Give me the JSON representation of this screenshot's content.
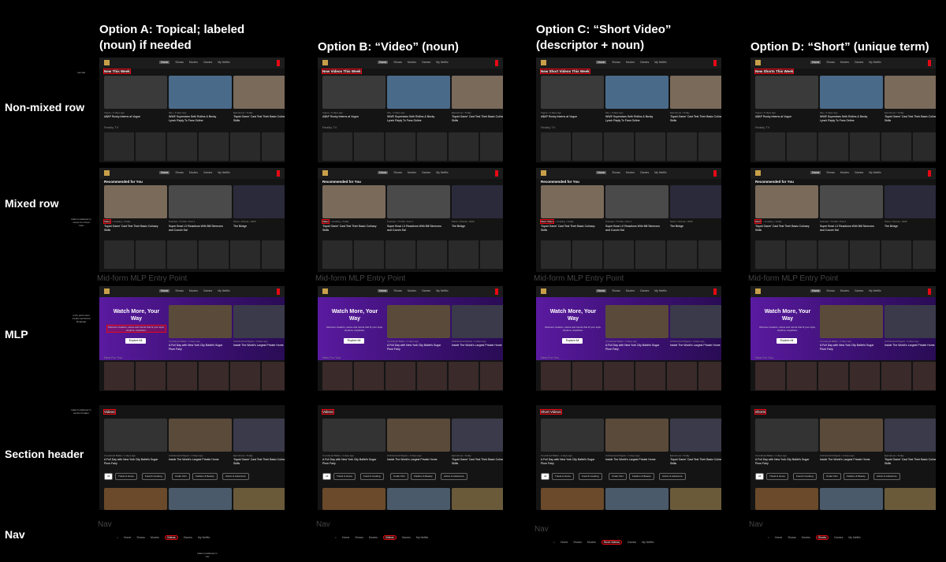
{
  "columns": [
    {
      "title": "Option A: Topical; labeled (noun) if needed",
      "nonmixed_row_title": "New This Week",
      "mixed_label": "Video",
      "section_header": "Videos",
      "nav_label": "Videos"
    },
    {
      "title": "Option B: “Video” (noun)",
      "nonmixed_row_title": "New Videos This Week",
      "mixed_label": "Video",
      "section_header": "Videos",
      "nav_label": "Videos"
    },
    {
      "title": "Option C: “Short Video” (descriptor + noun)",
      "nonmixed_row_title": "New Short Videos This Week",
      "mixed_label": "Short Video",
      "section_header": "Short Videos",
      "nav_label": "Short Videos"
    },
    {
      "title": "Option D: “Short” (unique term)",
      "nonmixed_row_title": "New Shorts This Week",
      "mixed_label": "Short",
      "section_header": "Shorts",
      "nav_label": "Shorts"
    }
  ],
  "row_labels": {
    "nonmixed": "Non-mixed row",
    "mixed": "Mixed row",
    "mlp": "MLP",
    "section": "Section header",
    "nav": "Nav"
  },
  "annotations": {
    "nonmixed": "row title",
    "mixed": "label considered in scope for mixed rows",
    "mlp": "entry point uses creator-anchored language",
    "section": "label considered in section header",
    "nav": "label considered in nav"
  },
  "top_nav": [
    "Home",
    "Shows",
    "Movies",
    "Games",
    "My Netflix"
  ],
  "bottom_nav": [
    "Home",
    "Shows",
    "Movies",
    "Games",
    "My Netflix"
  ],
  "nonmixed": {
    "cards": [
      {
        "meta": "Vogue • 5 days ago",
        "title": "A$AP Rocky Interns at Vogue"
      },
      {
        "meta": "Sky • 3 days ago",
        "title": "WWE Superstars Seth Rollins & Becky Lynch Reply To Fans Online"
      },
      {
        "meta": "Epicurious • Today",
        "title": "'Squid Game' Cast Test Their Basic Culinary Skills"
      }
    ],
    "sub": "Reality TV"
  },
  "mixed": {
    "row_title": "Recommended for You",
    "cards": [
      {
        "meta": "• Cooking • Today",
        "title": "'Squid Game' Cast Test Their Basic Culinary Skills"
      },
      {
        "meta": "Podcast • TV-MA • Part 1",
        "title": "Super Bowl LX Reactions With Bill Simmons and Cousin Sal"
      },
      {
        "meta": "Show • Drama • 2026",
        "title": "The Bridge"
      }
    ]
  },
  "mlp": {
    "caption": "Mid-form MLP Entry Point",
    "heading": "Watch More, Your Way",
    "body": "Discover creators, series and trends that fit your style, anytime, anywhere.",
    "button": "Explore All",
    "cards": [
      {
        "meta": "Crosslined Ballet • 4 days ago",
        "title": "A Full Day with New York City Ballet's Sugar Plum Fairy"
      },
      {
        "meta": "Architectural Digest • 3 days ago",
        "title": "Inside The World's Largest Private Home"
      }
    ],
    "sub": "New For You"
  },
  "section": {
    "cards": [
      {
        "meta": "Crosslined Ballet • 4 days ago",
        "title": "A Full Day with New York City Ballet's Sugar Plum Fairy"
      },
      {
        "meta": "Architectural Digest • 3 days ago",
        "title": "Inside The World's Largest Private Home"
      },
      {
        "meta": "Epicurious • Today",
        "title": "'Squid Game' Cast Test Their Basic Culinary Skills"
      }
    ],
    "chips": [
      "All",
      "Travel & Home",
      "Food & Cooking",
      "Under 10m",
      "Fashion & Beauty",
      "Action & Adventure"
    ]
  },
  "nav_caption": "Nav",
  "colors": {
    "accent": "#e50914",
    "mlp": "#5a1aa0",
    "panel": "#141414"
  }
}
